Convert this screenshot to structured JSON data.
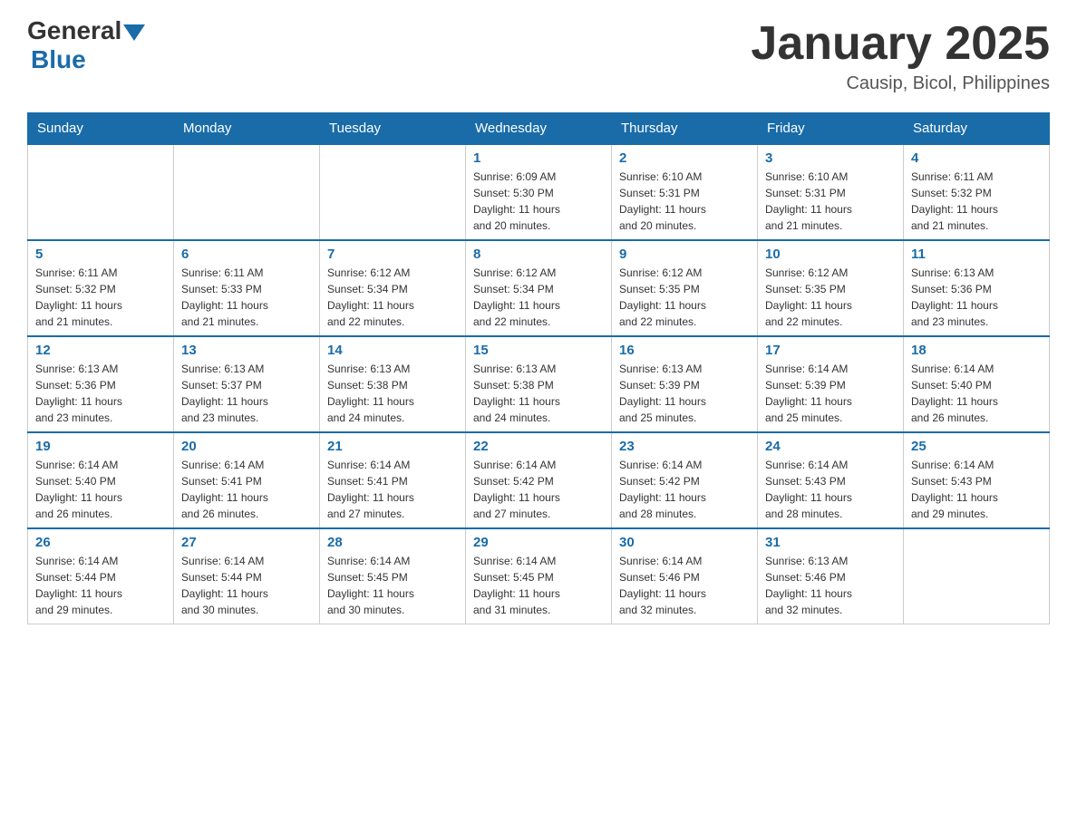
{
  "header": {
    "logo": {
      "general": "General",
      "blue": "Blue"
    },
    "title": "January 2025",
    "location": "Causip, Bicol, Philippines"
  },
  "weekdays": [
    "Sunday",
    "Monday",
    "Tuesday",
    "Wednesday",
    "Thursday",
    "Friday",
    "Saturday"
  ],
  "weeks": [
    [
      {
        "day": "",
        "info": ""
      },
      {
        "day": "",
        "info": ""
      },
      {
        "day": "",
        "info": ""
      },
      {
        "day": "1",
        "info": "Sunrise: 6:09 AM\nSunset: 5:30 PM\nDaylight: 11 hours\nand 20 minutes."
      },
      {
        "day": "2",
        "info": "Sunrise: 6:10 AM\nSunset: 5:31 PM\nDaylight: 11 hours\nand 20 minutes."
      },
      {
        "day": "3",
        "info": "Sunrise: 6:10 AM\nSunset: 5:31 PM\nDaylight: 11 hours\nand 21 minutes."
      },
      {
        "day": "4",
        "info": "Sunrise: 6:11 AM\nSunset: 5:32 PM\nDaylight: 11 hours\nand 21 minutes."
      }
    ],
    [
      {
        "day": "5",
        "info": "Sunrise: 6:11 AM\nSunset: 5:32 PM\nDaylight: 11 hours\nand 21 minutes."
      },
      {
        "day": "6",
        "info": "Sunrise: 6:11 AM\nSunset: 5:33 PM\nDaylight: 11 hours\nand 21 minutes."
      },
      {
        "day": "7",
        "info": "Sunrise: 6:12 AM\nSunset: 5:34 PM\nDaylight: 11 hours\nand 22 minutes."
      },
      {
        "day": "8",
        "info": "Sunrise: 6:12 AM\nSunset: 5:34 PM\nDaylight: 11 hours\nand 22 minutes."
      },
      {
        "day": "9",
        "info": "Sunrise: 6:12 AM\nSunset: 5:35 PM\nDaylight: 11 hours\nand 22 minutes."
      },
      {
        "day": "10",
        "info": "Sunrise: 6:12 AM\nSunset: 5:35 PM\nDaylight: 11 hours\nand 22 minutes."
      },
      {
        "day": "11",
        "info": "Sunrise: 6:13 AM\nSunset: 5:36 PM\nDaylight: 11 hours\nand 23 minutes."
      }
    ],
    [
      {
        "day": "12",
        "info": "Sunrise: 6:13 AM\nSunset: 5:36 PM\nDaylight: 11 hours\nand 23 minutes."
      },
      {
        "day": "13",
        "info": "Sunrise: 6:13 AM\nSunset: 5:37 PM\nDaylight: 11 hours\nand 23 minutes."
      },
      {
        "day": "14",
        "info": "Sunrise: 6:13 AM\nSunset: 5:38 PM\nDaylight: 11 hours\nand 24 minutes."
      },
      {
        "day": "15",
        "info": "Sunrise: 6:13 AM\nSunset: 5:38 PM\nDaylight: 11 hours\nand 24 minutes."
      },
      {
        "day": "16",
        "info": "Sunrise: 6:13 AM\nSunset: 5:39 PM\nDaylight: 11 hours\nand 25 minutes."
      },
      {
        "day": "17",
        "info": "Sunrise: 6:14 AM\nSunset: 5:39 PM\nDaylight: 11 hours\nand 25 minutes."
      },
      {
        "day": "18",
        "info": "Sunrise: 6:14 AM\nSunset: 5:40 PM\nDaylight: 11 hours\nand 26 minutes."
      }
    ],
    [
      {
        "day": "19",
        "info": "Sunrise: 6:14 AM\nSunset: 5:40 PM\nDaylight: 11 hours\nand 26 minutes."
      },
      {
        "day": "20",
        "info": "Sunrise: 6:14 AM\nSunset: 5:41 PM\nDaylight: 11 hours\nand 26 minutes."
      },
      {
        "day": "21",
        "info": "Sunrise: 6:14 AM\nSunset: 5:41 PM\nDaylight: 11 hours\nand 27 minutes."
      },
      {
        "day": "22",
        "info": "Sunrise: 6:14 AM\nSunset: 5:42 PM\nDaylight: 11 hours\nand 27 minutes."
      },
      {
        "day": "23",
        "info": "Sunrise: 6:14 AM\nSunset: 5:42 PM\nDaylight: 11 hours\nand 28 minutes."
      },
      {
        "day": "24",
        "info": "Sunrise: 6:14 AM\nSunset: 5:43 PM\nDaylight: 11 hours\nand 28 minutes."
      },
      {
        "day": "25",
        "info": "Sunrise: 6:14 AM\nSunset: 5:43 PM\nDaylight: 11 hours\nand 29 minutes."
      }
    ],
    [
      {
        "day": "26",
        "info": "Sunrise: 6:14 AM\nSunset: 5:44 PM\nDaylight: 11 hours\nand 29 minutes."
      },
      {
        "day": "27",
        "info": "Sunrise: 6:14 AM\nSunset: 5:44 PM\nDaylight: 11 hours\nand 30 minutes."
      },
      {
        "day": "28",
        "info": "Sunrise: 6:14 AM\nSunset: 5:45 PM\nDaylight: 11 hours\nand 30 minutes."
      },
      {
        "day": "29",
        "info": "Sunrise: 6:14 AM\nSunset: 5:45 PM\nDaylight: 11 hours\nand 31 minutes."
      },
      {
        "day": "30",
        "info": "Sunrise: 6:14 AM\nSunset: 5:46 PM\nDaylight: 11 hours\nand 32 minutes."
      },
      {
        "day": "31",
        "info": "Sunrise: 6:13 AM\nSunset: 5:46 PM\nDaylight: 11 hours\nand 32 minutes."
      },
      {
        "day": "",
        "info": ""
      }
    ]
  ]
}
